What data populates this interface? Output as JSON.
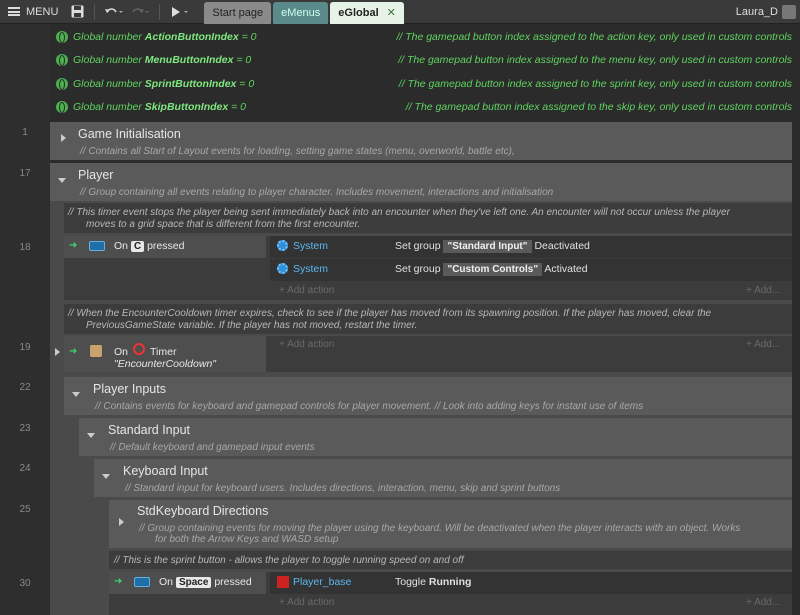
{
  "toolbar": {
    "menu_label": "MENU",
    "play_icon": "play-icon",
    "tabs": [
      {
        "label": "Start page"
      },
      {
        "label": "eMenus"
      },
      {
        "label": "eGlobal",
        "close": "✕"
      }
    ],
    "user": "Laura_D"
  },
  "globals": [
    {
      "prefix": "Global number ",
      "name": "ActionButtonIndex",
      "value": " = 0",
      "comment": "The gamepad button index assigned to the action key, only used in custom controls"
    },
    {
      "prefix": "Global number ",
      "name": "MenuButtonIndex",
      "value": " = 0",
      "comment": "The gamepad button index assigned to the menu key, only used in custom controls"
    },
    {
      "prefix": "Global number ",
      "name": "SprintButtonIndex",
      "value": " = 0",
      "comment": "The gamepad button index assigned to the sprint key, only used in custom controls"
    },
    {
      "prefix": "Global number ",
      "name": "SkipButtonIndex",
      "value": " = 0",
      "comment": "The gamepad button index assigned to the skip key, only used in custom controls"
    }
  ],
  "line_numbers": [
    "1",
    "17",
    "18",
    "19",
    "22",
    "23",
    "24",
    "25",
    "30"
  ],
  "groups": {
    "game_init": {
      "title": "Game Initialisation",
      "desc": "Contains all Start of Layout events for loading, setting game states (menu, overworld, battle etc),"
    },
    "player": {
      "title": "Player",
      "desc": "Group containing all events relating to player character. Includes movement, interactions and initialisation"
    },
    "player_inputs": {
      "title": "Player Inputs",
      "desc": "Contains events for keyboard and gamepad controls for player movement. // Look into adding keys for instant use of items"
    },
    "standard_input": {
      "title": "Standard Input",
      "desc": "Default keyboard and gamepad input events"
    },
    "keyboard_input": {
      "title": "Keyboard Input",
      "desc": "Standard input for keyboard users. Includes directions, interaction, menu, skip and sprint buttons"
    },
    "std_dirs": {
      "title": "StdKeyboard Directions",
      "desc1": "Group containing events for moving the player using the keyboard. Will be deactivated when the player interacts with an object. Works",
      "desc2": "for both the Arrow Keys and WASD setup"
    }
  },
  "comments": {
    "c1_line1": "This timer event stops the player being sent immediately back into an encounter when they've left one. An encounter will not occur unless the player",
    "c1_line2": "moves to a grid space that is different from the first encounter.",
    "c2_line1": "When the EncounterCooldown timer expires, check to see if the player has moved from its spawning position. If the player has moved, clear the",
    "c2_line2": "PreviousGameState variable. If the player has not moved, restart the timer.",
    "c3": "This is the sprint button - allows the player to toggle running speed on and off"
  },
  "event18": {
    "on": "On",
    "key": "C",
    "pressed": "pressed",
    "actions": [
      {
        "object": "System",
        "text": "Set group",
        "param": "\"Standard Input\"",
        "state": "Deactivated"
      },
      {
        "object": "System",
        "text": "Set group",
        "param": "\"Custom Controls\"",
        "state": "Activated"
      }
    ]
  },
  "event19": {
    "on": "On",
    "timer": "Timer",
    "name": "\"EncounterCooldown\""
  },
  "event30": {
    "on": "On",
    "key": "Space",
    "pressed": "pressed",
    "object": "Player_base",
    "action_prefix": "Toggle ",
    "action_bold": "Running"
  },
  "add_action": "+ Add action",
  "add_more": "+ Add..."
}
